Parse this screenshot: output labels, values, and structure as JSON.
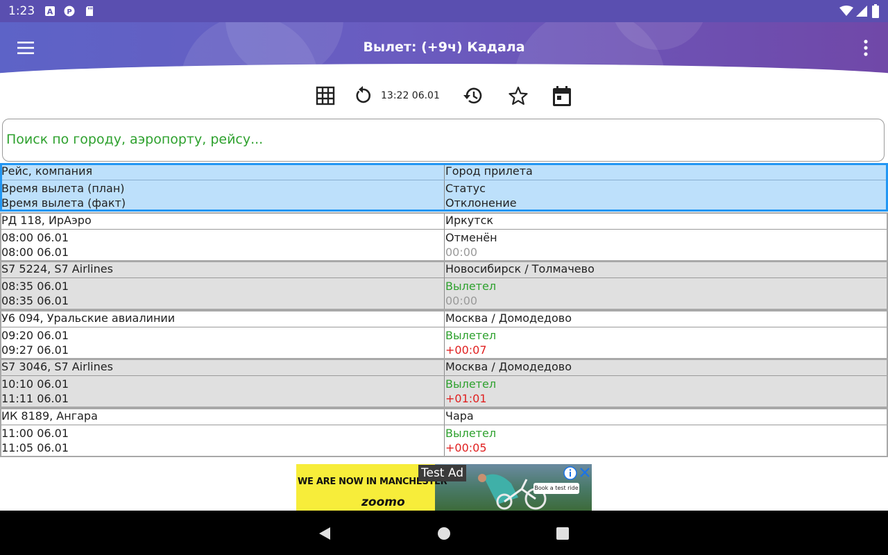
{
  "status_bar": {
    "time": "1:23",
    "left_icons": [
      "text-a-icon",
      "pocket-casts-icon",
      "sd-card-icon"
    ],
    "right_icons": [
      "wifi-icon",
      "cellular-signal-icon",
      "battery-icon"
    ]
  },
  "app_bar": {
    "title": "Вылет: (+9ч) Кадала",
    "menu_icon": "hamburger-menu-icon",
    "overflow_icon": "more-vert-icon"
  },
  "toolbar": {
    "grid_icon": "grid-view-icon",
    "refresh_icon": "refresh-icon",
    "last_update": "13:22 06.01",
    "history_icon": "history-icon",
    "favorite_icon": "star-outline-icon",
    "calendar_icon": "calendar-icon"
  },
  "search": {
    "placeholder": "Поиск по городу, аэропорту, рейсу...",
    "value": ""
  },
  "table": {
    "header": {
      "flight_company": "Рейс, компания",
      "destination": "Город прилета",
      "planned_time": "Время вылета (план)",
      "status": "Статус",
      "actual_time": "Время вылета (факт)",
      "deviation": "Отклонение"
    },
    "rows": [
      {
        "flight": "РД 118, ИрАэро",
        "destination": "Иркутск",
        "planned": "08:00 06.01",
        "status": "Отменён",
        "actual": "08:00 06.01",
        "deviation": "00:00"
      },
      {
        "flight": "S7 5224, S7 Airlines",
        "destination": "Новосибирск / Толмачево",
        "planned": "08:35 06.01",
        "status": "Вылетел",
        "actual": "08:35 06.01",
        "deviation": "00:00"
      },
      {
        "flight": "У6 094, Уральские авиалинии",
        "destination": "Москва / Домодедово",
        "planned": "09:20 06.01",
        "status": "Вылетел",
        "actual": "09:27 06.01",
        "deviation": "+00:07"
      },
      {
        "flight": "S7 3046, S7 Airlines",
        "destination": "Москва / Домодедово",
        "planned": "10:10 06.01",
        "status": "Вылетел",
        "actual": "11:11 06.01",
        "deviation": "+01:01"
      },
      {
        "flight": "ИК 8189, Ангара",
        "destination": "Чара",
        "planned": "11:00 06.01",
        "status": "Вылетел",
        "actual": "11:05 06.01",
        "deviation": "+00:05"
      }
    ]
  },
  "ad": {
    "label": "Test Ad",
    "headline": "WE ARE NOW IN MANCHESTER",
    "brand": "zoomo",
    "cta": "Book a test ride",
    "info_icon": "info-icon",
    "close_icon": "close-icon"
  },
  "nav_bar": {
    "back_icon": "back-triangle-icon",
    "home_icon": "home-circle-icon",
    "recents_icon": "recents-square-icon"
  },
  "colors": {
    "appbar_start": "#5d63c7",
    "appbar_end": "#7048a8",
    "header_bg": "#bde0fb",
    "header_border": "#2196f3",
    "status_green": "#2ea12e",
    "delay_red": "#e02020",
    "zero_gray": "#9a9a9a",
    "row_alt_bg": "#e0e0e0"
  }
}
